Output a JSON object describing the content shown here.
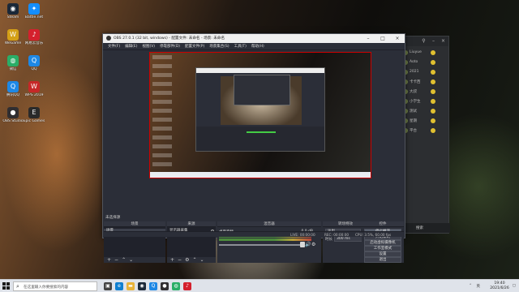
{
  "desktop": {
    "icons": [
      {
        "label": "Steam",
        "icon": "steam-icon",
        "color": "#1b2838"
      },
      {
        "label": "Battle.net",
        "icon": "battlenet-icon",
        "color": "#148eff"
      },
      {
        "label": "WeGame",
        "icon": "wegame-icon",
        "color": "#d4a017"
      },
      {
        "label": "网易云音乐",
        "icon": "music-icon",
        "color": "#d4202d"
      },
      {
        "label": "微信",
        "icon": "wechat-icon",
        "color": "#2aae67"
      },
      {
        "label": "QQ",
        "icon": "qq-icon",
        "color": "#1e88e5"
      },
      {
        "label": "腾讯QQ",
        "icon": "qq-icon",
        "color": "#1e88e5"
      },
      {
        "label": "WPS 2019",
        "icon": "wps-icon",
        "color": "#c62828"
      },
      {
        "label": "OBS Studio",
        "icon": "obs-icon",
        "color": "#302e31"
      },
      {
        "label": "Epic Games",
        "icon": "epic-icon",
        "color": "#2a2a2a"
      }
    ]
  },
  "chat": {
    "rows": [
      "Liuyue",
      "Aoto",
      "2021",
      "卡卡西",
      "大叔",
      "小学生",
      "测试",
      "星期",
      "平台"
    ],
    "reply_label": "搜索"
  },
  "obs": {
    "title": "OBS 27.0.1 (32 bit, windows) - 配置文件: 未命名 - 场景: 未命名",
    "menu": [
      "文件(F)",
      "编辑(E)",
      "视图(V)",
      "停靠部件(D)",
      "配置文件(P)",
      "场景集合(S)",
      "工具(T)",
      "帮助(H)"
    ],
    "docks": {
      "scenes": {
        "title": "未选择源",
        "header": "场景",
        "items": [
          "场景"
        ]
      },
      "sources": {
        "header": "来源",
        "items": [
          "显示器采集"
        ]
      },
      "mixer": {
        "header": "混音器",
        "track_label": "桌面音频",
        "db": "0.0 dB"
      },
      "transitions": {
        "header": "转场特效",
        "selected": "淡出",
        "duration_label": "时长",
        "duration": "300 ms"
      },
      "controls": {
        "header": "控件",
        "buttons": [
          "停止推流",
          "开始录制",
          "启动虚拟摄像机",
          "工作室模式",
          "设置",
          "退出"
        ]
      }
    },
    "status": {
      "live": "LIVE: 00:00:00",
      "rec": "REC: 00:00:00",
      "cpu": "CPU: 3.5%, 60.00 fps",
      "bitrate": "kb/s: 2500"
    }
  },
  "taskbar": {
    "search_placeholder": "在这里输入你要搜索的内容",
    "apps": [
      {
        "icon": "task-view-icon",
        "color": "#444"
      },
      {
        "icon": "edge-icon",
        "color": "#0f7fd1"
      },
      {
        "icon": "folder-icon",
        "color": "#e8b33a"
      },
      {
        "icon": "steam-icon",
        "color": "#1b2838"
      },
      {
        "icon": "qq-icon",
        "color": "#1e88e5"
      },
      {
        "icon": "obs-icon",
        "color": "#302e31"
      },
      {
        "icon": "wechat-icon",
        "color": "#2aae67"
      },
      {
        "icon": "music-icon",
        "color": "#d4202d"
      }
    ],
    "tray": {
      "lang": "英",
      "time": "19:40",
      "date": "2021/6/26"
    }
  }
}
